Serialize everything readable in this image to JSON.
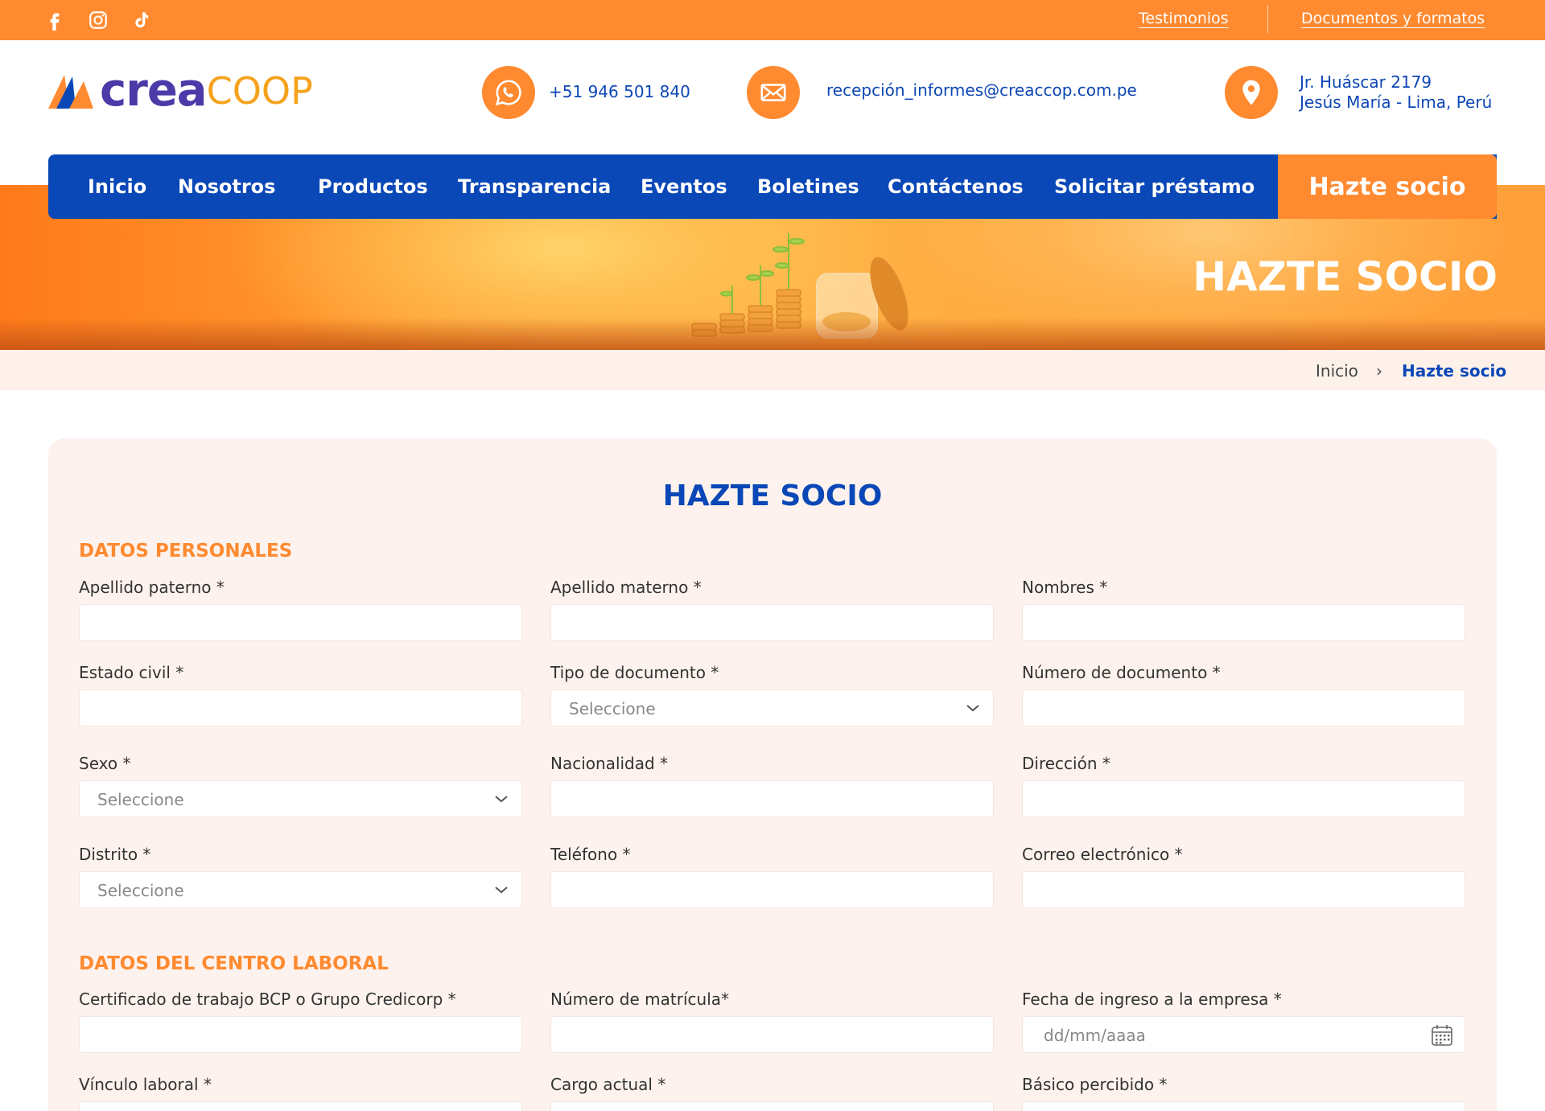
{
  "topbar": {
    "links": [
      "Testimonios",
      "Documentos y formatos"
    ],
    "social_icons": [
      "facebook-icon",
      "instagram-icon",
      "tiktok-icon"
    ]
  },
  "brand": {
    "logo_part1": "crea",
    "logo_part2": "COOP",
    "colors": {
      "orange": "#ff8a30",
      "blue": "#0a47b7",
      "purple": "#4b3aa8",
      "gold": "#f5a21c"
    }
  },
  "contact": {
    "phone": "+51 946 501 840",
    "email": "recepción_informes@creaccop.com.pe",
    "address_line1": "Jr. Huáscar 2179",
    "address_line2": "Jesús María - Lima, Perú"
  },
  "nav": {
    "items": [
      "Inicio",
      "Nosotros",
      "Productos",
      "Transparencia",
      "Eventos",
      "Boletines",
      "Contáctenos",
      "Solicitar préstamo"
    ],
    "cta": "Hazte socio"
  },
  "banner": {
    "title": "HAZTE SOCIO"
  },
  "breadcrumb": {
    "home": "Inicio",
    "separator": "›",
    "current": "Hazte socio"
  },
  "form": {
    "title": "HAZTE SOCIO",
    "section1": "DATOS PERSONALES",
    "section2": "DATOS DEL CENTRO LABORAL",
    "fields": {
      "apellido_paterno": "Apellido paterno *",
      "apellido_materno": "Apellido materno *",
      "nombres": "Nombres *",
      "estado_civil": "Estado civil *",
      "tipo_documento": "Tipo de documento *",
      "numero_documento": "Número de documento *",
      "sexo": "Sexo *",
      "nacionalidad": "Nacionalidad *",
      "direccion": "Dirección *",
      "distrito": "Distrito *",
      "telefono": "Teléfono *",
      "correo": "Correo electrónico *",
      "certificado": "Certificado de trabajo BCP o Grupo Credicorp *",
      "matricula": "Número de matrícula*",
      "fecha_ingreso": "Fecha de ingreso a la empresa *",
      "vinculo": "Vínculo laboral *",
      "cargo": "Cargo actual *",
      "basico": "Básico percibido *"
    },
    "select_placeholder": "Seleccione",
    "date_placeholder": "dd/mm/aaaa"
  }
}
